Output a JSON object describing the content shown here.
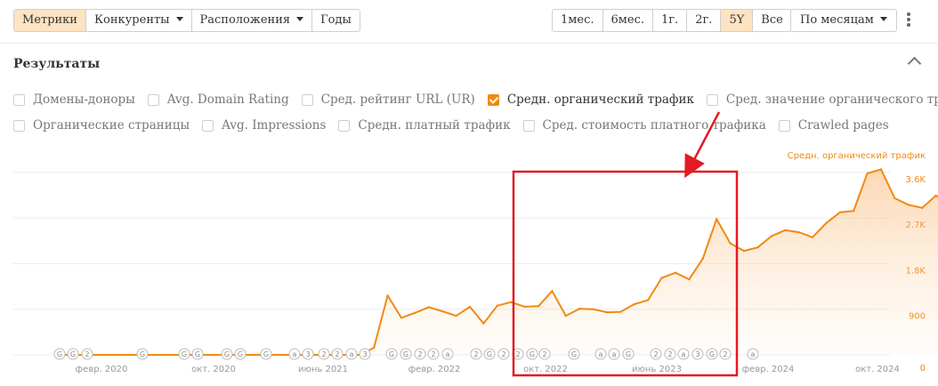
{
  "toolbar": {
    "tabs": [
      {
        "label": "Метрики",
        "active": true
      },
      {
        "label": "Конкуренты",
        "dropdown": true
      },
      {
        "label": "Расположения",
        "dropdown": true
      },
      {
        "label": "Годы"
      }
    ],
    "ranges": [
      {
        "label": "1мес."
      },
      {
        "label": "6мес."
      },
      {
        "label": "1г."
      },
      {
        "label": "2г."
      },
      {
        "label": "5Y",
        "active": true
      },
      {
        "label": "Все"
      }
    ],
    "interval": "По месяцам"
  },
  "results": {
    "title": "Результаты",
    "row1": [
      {
        "label": "Домены-доноры",
        "checked": false
      },
      {
        "label": "Avg. Domain Rating",
        "checked": false
      },
      {
        "label": "Сред. рейтинг URL (UR)",
        "checked": false
      },
      {
        "label": "Средн. органический трафик",
        "checked": true
      },
      {
        "label": "Сред. значение органического трафика",
        "checked": false
      }
    ],
    "row2": [
      {
        "label": "Органические страницы",
        "checked": false
      },
      {
        "label": "Avg. Impressions",
        "checked": false
      },
      {
        "label": "Средн. платный трафик",
        "checked": false
      },
      {
        "label": "Сред. стоимость платного трафика",
        "checked": false
      },
      {
        "label": "Crawled pages",
        "checked": false
      }
    ]
  },
  "chart_data": {
    "type": "area",
    "series": [
      {
        "name": "Средн. органический трафик",
        "color": "#f08a10",
        "values": [
          0,
          0,
          0,
          0,
          0,
          0,
          0,
          0,
          0,
          0,
          0,
          0,
          0,
          0,
          0,
          0,
          0,
          0,
          0,
          0,
          0,
          0,
          0,
          140,
          1170,
          730,
          830,
          940,
          860,
          770,
          950,
          620,
          970,
          1040,
          950,
          960,
          1260,
          770,
          910,
          900,
          840,
          850,
          1000,
          1080,
          1520,
          1620,
          1490,
          1900,
          2680,
          2200,
          2050,
          2120,
          2340,
          2460,
          2420,
          2320,
          2600,
          2810,
          2840,
          3580,
          3660,
          3090,
          2960,
          2900,
          3140,
          3000,
          3370,
          3220
        ],
        "style": "line with light gradient area fill"
      }
    ],
    "x_range": [
      "янв. 2019",
      "авг. 2024"
    ],
    "x_tick_labels": [
      "февр. 2020",
      "окт. 2020",
      "июнь 2021",
      "февр. 2022",
      "окт. 2022",
      "июнь 2023",
      "февр. 2024",
      "окт. 2024"
    ],
    "y_tick_labels": [
      "0",
      "900",
      "1.8K",
      "2.7K",
      "3.6K"
    ],
    "ylim": [
      0,
      3900
    ],
    "y_axis_side": "right",
    "y_axis_title": "Средн. органический трафик",
    "grid": true,
    "annotation_markers": [
      "G",
      "G",
      "2",
      "G",
      "G",
      "G",
      "G",
      "G",
      "G",
      "a",
      "3",
      "2",
      "2",
      "a",
      "3",
      "G",
      "G",
      "2",
      "2",
      "a",
      "2",
      "G",
      "2",
      "2",
      "G",
      "2",
      "G",
      "a",
      "a",
      "G",
      "2",
      "2",
      "a",
      "3",
      "G",
      "2",
      "a"
    ],
    "highlight": {
      "type": "rectangle with arrow",
      "color": "#e31b23",
      "range": [
        "авг. 2022",
        "сент. 2023"
      ]
    }
  }
}
